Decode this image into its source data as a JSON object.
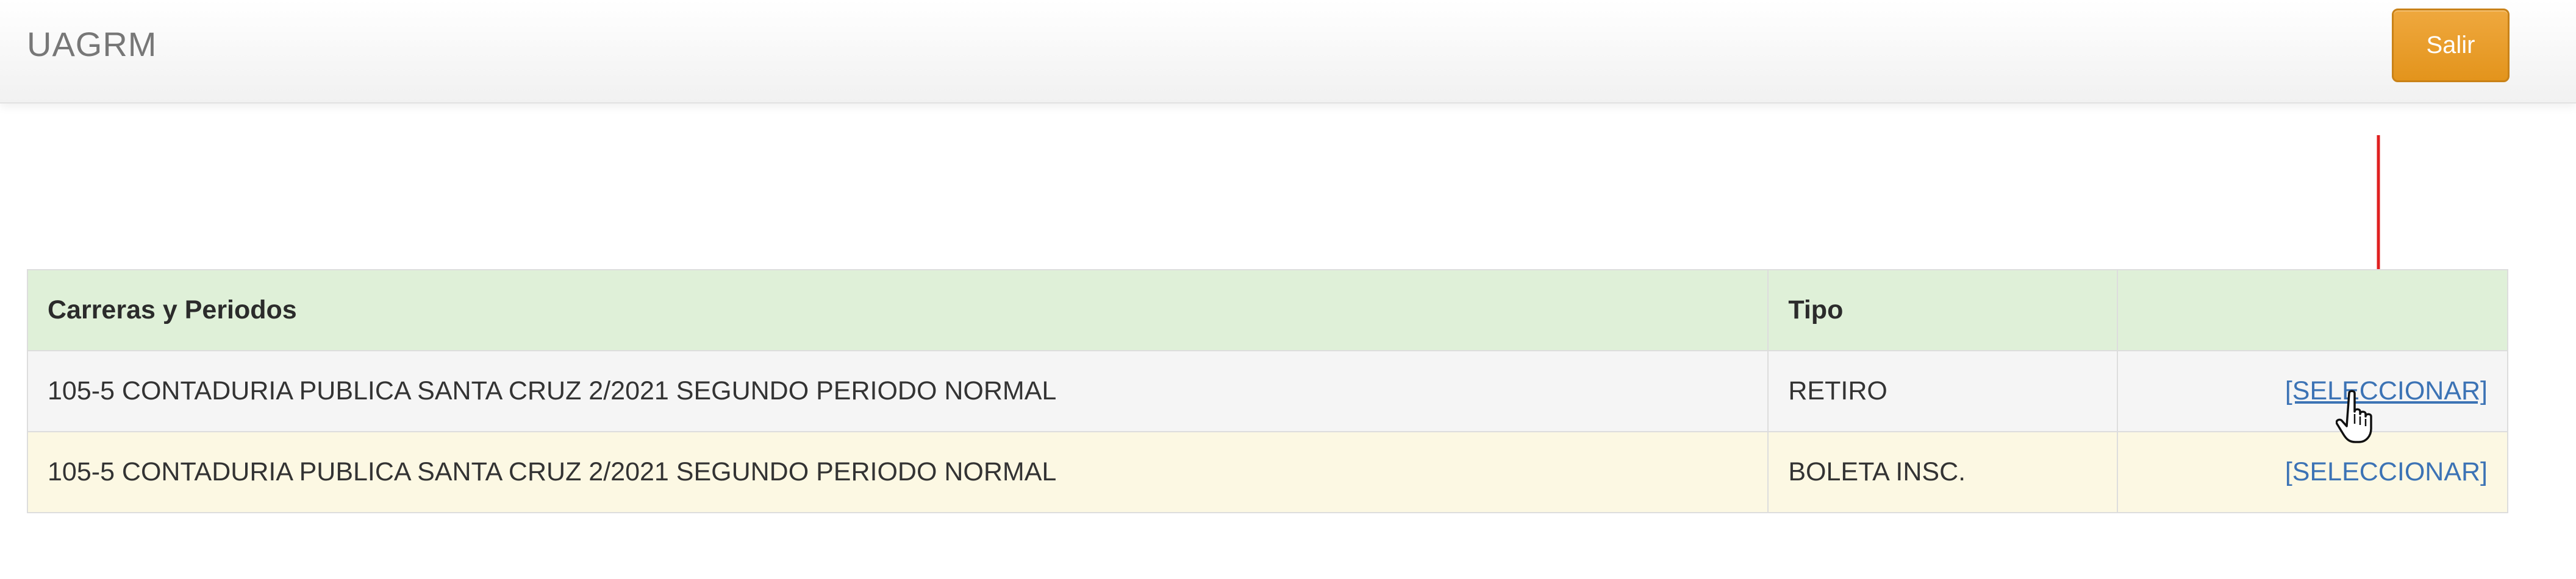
{
  "navbar": {
    "brand": "UAGRM",
    "logout_label": "Salir",
    "logout_color": "#e59b25"
  },
  "table": {
    "headers": [
      "Carreras y Periodos",
      "Tipo",
      ""
    ],
    "rows": [
      {
        "carrera": "105-5 CONTADURIA PUBLICA SANTA CRUZ 2/2021 SEGUNDO PERIODO NORMAL",
        "tipo": "RETIRO",
        "action": "[SELECCIONAR]"
      },
      {
        "carrera": "105-5 CONTADURIA PUBLICA SANTA CRUZ 2/2021 SEGUNDO PERIODO NORMAL",
        "tipo": "BOLETA INSC.",
        "action": "[SELECCIONAR]"
      }
    ],
    "header_color": "#dff0d8",
    "row_colors": [
      "#f5f5f5",
      "#fcf8e3"
    ],
    "link_color": "#3c73b5"
  },
  "annotations": {
    "arrow_icon": "arrow-down-icon",
    "arrow_color": "#e02020",
    "cursor_icon": "hand-pointer-icon"
  }
}
